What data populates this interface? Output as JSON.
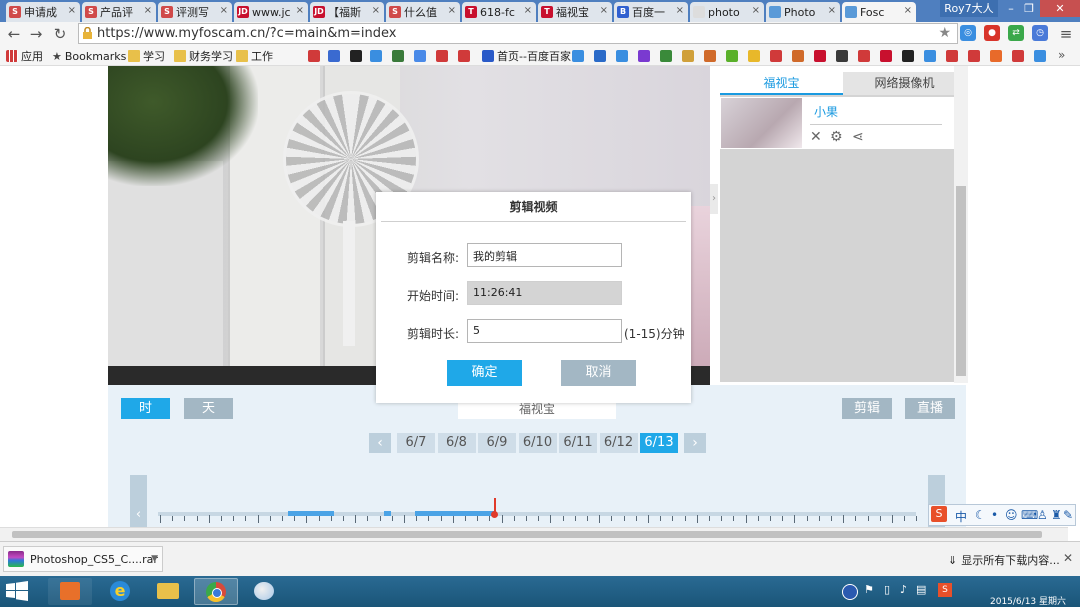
{
  "browser": {
    "tabs": [
      {
        "title": "申请成",
        "icon": "S",
        "color": "#d04a4a"
      },
      {
        "title": "产品评",
        "icon": "S",
        "color": "#d04a4a"
      },
      {
        "title": "评测写",
        "icon": "S",
        "color": "#d04a4a"
      },
      {
        "title": "www.jc",
        "icon": "JD",
        "color": "#c8102e"
      },
      {
        "title": "【福斯",
        "icon": "JD",
        "color": "#c8102e"
      },
      {
        "title": "什么值",
        "icon": "S",
        "color": "#d04a4a"
      },
      {
        "title": "618-fc",
        "icon": "T",
        "color": "#c8102e"
      },
      {
        "title": "福视宝",
        "icon": "T",
        "color": "#c8102e"
      },
      {
        "title": "百度一",
        "icon": "B",
        "color": "#3060d0"
      },
      {
        "title": "photo",
        "icon": "",
        "color": "#dddddd"
      },
      {
        "title": "Photo",
        "icon": "",
        "color": "#5a9ad8"
      },
      {
        "title": "Fosc",
        "icon": "",
        "color": "#5a9ad8"
      }
    ],
    "profile": "Roy7大人",
    "url": "https://www.myfoscam.cn/?c=main&m=index",
    "bookmarks": {
      "apps": "应用",
      "bookmarks": "Bookmarks",
      "folder1": "学习",
      "folder2": "财务学习",
      "folder3": "工作",
      "baidu_home": "首页--百度百家"
    }
  },
  "side_panel": {
    "tab1": "福视宝",
    "tab2": "网络摄像机",
    "camera_name": "小果"
  },
  "controls": {
    "hour": "时",
    "day": "天",
    "center_label": "福视宝",
    "clip": "剪辑",
    "live": "直播"
  },
  "dates": [
    "6/7",
    "6/8",
    "6/9",
    "6/10",
    "6/11",
    "6/12",
    "6/13"
  ],
  "selected_date": "6/13",
  "modal": {
    "title": "剪辑视频",
    "name_label": "剪辑名称:",
    "name_value": "我的剪辑",
    "start_label": "开始时间:",
    "start_value": "11:26:41",
    "duration_label": "剪辑时长:",
    "duration_value": "5",
    "duration_hint": "(1-15)分钟",
    "ok": "确定",
    "cancel": "取消"
  },
  "ime": {
    "lang": "中"
  },
  "downloads": {
    "file": "Photoshop_CS5_C....rar",
    "show_all": "显示所有下载内容..."
  },
  "taskbar": {
    "time": "2015/6/13 星期六"
  }
}
